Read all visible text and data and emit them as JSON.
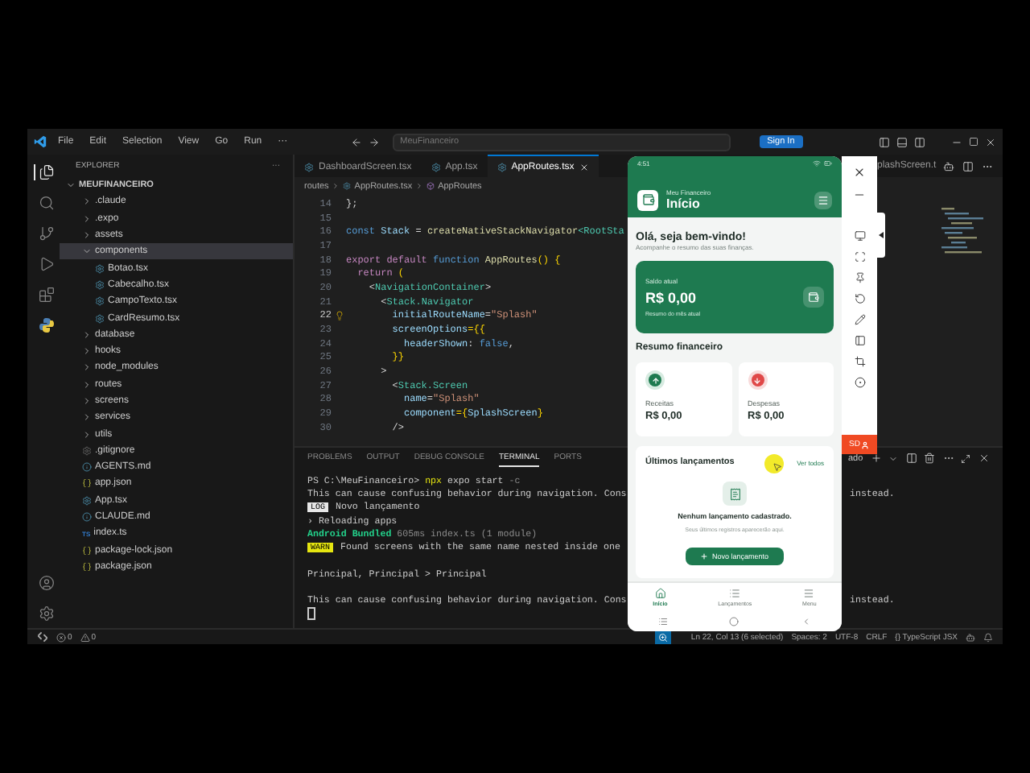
{
  "titlebar": {
    "menus": [
      "File",
      "Edit",
      "Selection",
      "View",
      "Go",
      "Run",
      "···"
    ],
    "search": "MeuFinanceiro",
    "sign_in": "Sign In"
  },
  "activity_bar": {
    "top": [
      {
        "kind": "explorer",
        "selected": true
      },
      {
        "kind": "search",
        "selected": false
      },
      {
        "kind": "source-control",
        "selected": false
      },
      {
        "kind": "run",
        "selected": false
      },
      {
        "kind": "extensions",
        "selected": false
      },
      {
        "kind": "python",
        "selected": false
      }
    ],
    "bottom": [
      {
        "kind": "account"
      },
      {
        "kind": "settings"
      }
    ]
  },
  "sidebar": {
    "title": "EXPLORER",
    "more": "···",
    "root": "MEUFINANCEIRO",
    "tree": [
      {
        "label": ".claude",
        "kind": "folder",
        "expanded": false,
        "selected": false
      },
      {
        "label": ".expo",
        "kind": "folder",
        "expanded": false,
        "selected": false
      },
      {
        "label": "assets",
        "kind": "folder",
        "expanded": false,
        "selected": false
      },
      {
        "label": "components",
        "kind": "folder",
        "expanded": true,
        "selected": true,
        "children": [
          {
            "label": "Botao.tsx",
            "kind": "tsx",
            "selected": false
          },
          {
            "label": "Cabecalho.tsx",
            "kind": "tsx",
            "selected": false
          },
          {
            "label": "CampoTexto.tsx",
            "kind": "tsx",
            "selected": false
          },
          {
            "label": "CardResumo.tsx",
            "kind": "tsx",
            "selected": false
          }
        ]
      },
      {
        "label": "database",
        "kind": "folder",
        "expanded": false,
        "selected": false
      },
      {
        "label": "hooks",
        "kind": "folder",
        "expanded": false,
        "selected": false
      },
      {
        "label": "node_modules",
        "kind": "folder",
        "expanded": false,
        "selected": false
      },
      {
        "label": "routes",
        "kind": "folder",
        "expanded": false,
        "selected": false
      },
      {
        "label": "screens",
        "kind": "folder",
        "expanded": false,
        "selected": false
      },
      {
        "label": "services",
        "kind": "folder",
        "expanded": false,
        "selected": false
      },
      {
        "label": "utils",
        "kind": "folder",
        "expanded": false,
        "selected": false
      },
      {
        "label": ".gitignore",
        "kind": "git",
        "selected": false
      },
      {
        "label": "AGENTS.md",
        "kind": "md",
        "selected": false
      },
      {
        "label": "app.json",
        "kind": "json",
        "selected": false
      },
      {
        "label": "App.tsx",
        "kind": "tsx",
        "selected": false
      },
      {
        "label": "CLAUDE.md",
        "kind": "md",
        "selected": false
      },
      {
        "label": "index.ts",
        "kind": "ts",
        "icon_text": "TS",
        "selected": false
      },
      {
        "label": "package-lock.json",
        "kind": "json",
        "selected": false
      },
      {
        "label": "package.json",
        "kind": "json",
        "selected": false
      }
    ]
  },
  "editor": {
    "tabs": [
      {
        "label": "DashboardScreen.tsx",
        "selected": false
      },
      {
        "label": "App.tsx",
        "selected": false
      },
      {
        "label": "AppRoutes.tsx",
        "selected": true
      }
    ],
    "far_tab": "plashScreen.t",
    "breadcrumb": [
      "routes",
      "AppRoutes.tsx",
      "AppRoutes"
    ],
    "lines": [
      {
        "n": "14",
        "tokens": [
          {
            "t": "};",
            "kind": "punct"
          }
        ]
      },
      {
        "n": "15"
      },
      {
        "n": "16",
        "tokens": [
          {
            "t": "const ",
            "kind": "keyword"
          },
          {
            "t": "Stack",
            "kind": "variable"
          },
          {
            "t": " = ",
            "kind": "punct"
          },
          {
            "t": "createNativeStackNavigator",
            "kind": "function"
          },
          {
            "t": "<RootSta",
            "kind": "type"
          }
        ]
      },
      {
        "n": "17"
      },
      {
        "n": "18",
        "tokens": [
          {
            "t": "export default ",
            "kind": "control"
          },
          {
            "t": "function ",
            "kind": "keyword"
          },
          {
            "t": "AppRoutes",
            "kind": "function"
          },
          {
            "t": "() {",
            "kind": "bracket"
          }
        ]
      },
      {
        "n": "19",
        "tokens": [
          {
            "t": "  return ",
            "kind": "control"
          },
          {
            "t": "(",
            "kind": "bracket"
          }
        ]
      },
      {
        "n": "20",
        "tokens": [
          {
            "t": "    <",
            "kind": "punct"
          },
          {
            "t": "NavigationContainer",
            "kind": "tag"
          },
          {
            "t": ">",
            "kind": "punct"
          }
        ]
      },
      {
        "n": "21",
        "tokens": [
          {
            "t": "      <",
            "kind": "punct"
          },
          {
            "t": "Stack.Navigator",
            "kind": "tag"
          }
        ]
      },
      {
        "n": "22",
        "lightbulb": true,
        "tokens": [
          {
            "t": "        initialRouteName",
            "kind": "attribute"
          },
          {
            "t": "=",
            "kind": "punct"
          },
          {
            "t": "\"Splash\"",
            "kind": "string"
          }
        ]
      },
      {
        "n": "23",
        "tokens": [
          {
            "t": "        screenOptions",
            "kind": "attribute"
          },
          {
            "t": "={{",
            "kind": "bracket"
          }
        ]
      },
      {
        "n": "24",
        "tokens": [
          {
            "t": "          headerShown",
            "kind": "attribute"
          },
          {
            "t": ": ",
            "kind": "punct"
          },
          {
            "t": "false",
            "kind": "keyword"
          },
          {
            "t": ",",
            "kind": "punct"
          }
        ]
      },
      {
        "n": "25",
        "tokens": [
          {
            "t": "        }}",
            "kind": "bracket"
          }
        ]
      },
      {
        "n": "26",
        "tokens": [
          {
            "t": "      >",
            "kind": "punct"
          }
        ]
      },
      {
        "n": "27",
        "tokens": [
          {
            "t": "        <",
            "kind": "punct"
          },
          {
            "t": "Stack.Screen",
            "kind": "tag"
          }
        ]
      },
      {
        "n": "28",
        "tokens": [
          {
            "t": "          name",
            "kind": "attribute"
          },
          {
            "t": "=",
            "kind": "punct"
          },
          {
            "t": "\"Splash\"",
            "kind": "string"
          }
        ]
      },
      {
        "n": "29",
        "tokens": [
          {
            "t": "          component",
            "kind": "attribute"
          },
          {
            "t": "={",
            "kind": "bracket"
          },
          {
            "t": "SplashScreen",
            "kind": "variable"
          },
          {
            "t": "}",
            "kind": "bracket"
          }
        ]
      },
      {
        "n": "30",
        "tokens": [
          {
            "t": "        />",
            "kind": "punct"
          }
        ]
      }
    ]
  },
  "panel": {
    "tabs": [
      {
        "label": "PROBLEMS",
        "selected": false
      },
      {
        "label": "OUTPUT",
        "selected": false
      },
      {
        "label": "DEBUG CONSOLE",
        "selected": false
      },
      {
        "label": "TERMINAL",
        "selected": true
      },
      {
        "label": "PORTS",
        "selected": false
      }
    ],
    "terminal_name": "ado",
    "terminal": [
      {
        "kind": "text",
        "tokens": [
          {
            "t": "PS C:\\MeuFinanceiro> ",
            "kind": "plain"
          },
          {
            "t": "npx",
            "kind": "command"
          },
          {
            "t": " expo start ",
            "kind": "plain"
          },
          {
            "t": "-c",
            "kind": "dim"
          }
        ]
      },
      {
        "kind": "text",
        "tokens": [
          {
            "t": "This can cause confusing behavior during navigation. Cons",
            "kind": "plain"
          }
        ],
        "tail": "instead."
      },
      {
        "kind": "text",
        "tokens": [
          {
            "t": "LOG",
            "kind": "log"
          },
          {
            "t": " Novo lançamento",
            "kind": "plain"
          }
        ]
      },
      {
        "kind": "text",
        "tokens": [
          {
            "t": "› Reloading apps",
            "kind": "plain"
          }
        ]
      },
      {
        "kind": "text",
        "tokens": [
          {
            "t": "Android Bundled ",
            "kind": "success"
          },
          {
            "t": "605ms index.ts (1 module)",
            "kind": "dim"
          }
        ]
      },
      {
        "kind": "text",
        "tokens": [
          {
            "t": "WARN",
            "kind": "warn"
          },
          {
            "t": " Found screens with the same name nested inside one",
            "kind": "plain"
          }
        ]
      },
      {
        "kind": "blank"
      },
      {
        "kind": "text",
        "tokens": [
          {
            "t": "Principal, Principal > Principal",
            "kind": "plain"
          }
        ]
      },
      {
        "kind": "blank"
      },
      {
        "kind": "text",
        "tokens": [
          {
            "t": "This can cause confusing behavior during navigation. Cons",
            "kind": "plain"
          }
        ],
        "tail": "instead."
      },
      {
        "kind": "cursor"
      }
    ]
  },
  "status_bar": {
    "errors": "0",
    "warnings": "0",
    "items": [
      "Ln 22, Col 13 (6 selected)",
      "Spaces: 2",
      "UTF-8",
      "CRLF",
      "{} TypeScript JSX"
    ]
  },
  "phone": {
    "time": "4:51",
    "app_name": "Meu Financeiro",
    "title": "Início",
    "greeting": "Olá, seja bem-vindo!",
    "subtitle": "Acompanhe o resumo das suas finanças.",
    "balance": {
      "label": "Saldo atual",
      "value": "R$ 0,00",
      "note": "Resumo do mês atual"
    },
    "summary_title": "Resumo financeiro",
    "summary": [
      {
        "kind": "income",
        "label": "Receitas",
        "value": "R$ 0,00"
      },
      {
        "kind": "expense",
        "label": "Despesas",
        "value": "R$ 0,00"
      }
    ],
    "recent": {
      "title": "Últimos lançamentos",
      "link": "Ver todos",
      "empty_title": "Nenhum lançamento cadastrado.",
      "empty_text": "Seus últimos registros aparecerão aqui.",
      "button": "Novo lançamento"
    },
    "nav": [
      {
        "kind": "home",
        "label": "Início",
        "selected": true
      },
      {
        "kind": "list",
        "label": "Lançamentos",
        "selected": false
      },
      {
        "kind": "menu",
        "label": "Menu",
        "selected": false
      }
    ]
  },
  "emulator_toolbar": {
    "record": "SD"
  }
}
